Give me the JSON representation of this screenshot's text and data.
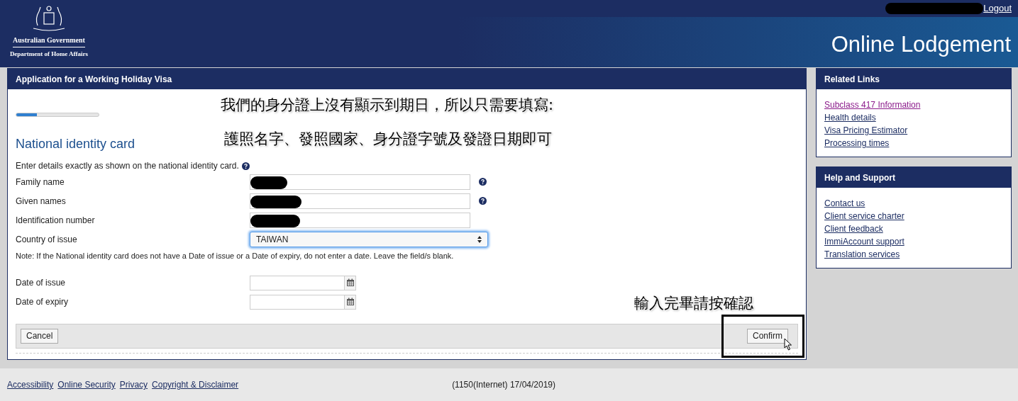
{
  "header": {
    "agency_line_1": "Australian Government",
    "agency_line_2": "Department of Home Affairs",
    "logout": "Logout",
    "site_title": "Online Lodgement"
  },
  "form": {
    "title": "Application for a Working Holiday Visa",
    "progress": {
      "level": 0.25
    },
    "section_title": "National identity card",
    "intro": "Enter details exactly as shown on the national identity card.",
    "fields": [
      {
        "kind": "text",
        "label": "Family name",
        "redacted": true,
        "help": true
      },
      {
        "kind": "text",
        "label": "Given names",
        "redacted": true,
        "help": true
      },
      {
        "kind": "text",
        "label": "Identification number",
        "redacted": true,
        "help": false
      },
      {
        "kind": "select",
        "label": "Country of issue",
        "value": "TAIWAN",
        "focused": true
      }
    ],
    "note": "Note: If the National identity card does not have a Date of issue or a Date of expiry, do not enter a date. Leave the field/s blank.",
    "date_fields": [
      {
        "label": "Date of issue"
      },
      {
        "label": "Date of expiry"
      }
    ],
    "buttons": {
      "cancel": "Cancel",
      "confirm": "Confirm"
    }
  },
  "annotations": [
    {
      "text": "我們的身分證上沒有顯示到期日，所以只需要填寫:"
    },
    {
      "text": "護照名字、發照國家、身分證字號及發證日期即可"
    },
    {
      "text": "輸入完畢請按確認"
    }
  ],
  "sidebar": [
    {
      "title": "Related Links",
      "links": [
        {
          "label": "Subclass 417 Information",
          "visited": true
        },
        {
          "label": "Health details",
          "visited": false
        },
        {
          "label": "Visa Pricing Estimator",
          "visited": false
        },
        {
          "label": "Processing times",
          "visited": false
        }
      ]
    },
    {
      "title": "Help and Support",
      "links": [
        {
          "label": "Contact us",
          "visited": false
        },
        {
          "label": "Client service charter",
          "visited": false
        },
        {
          "label": "Client feedback",
          "visited": false
        },
        {
          "label": "ImmiAccount support",
          "visited": false
        },
        {
          "label": "Translation services",
          "visited": false
        }
      ]
    }
  ],
  "footer": {
    "links": [
      "Accessibility",
      "Online Security",
      "Privacy",
      "Copyright & Disclaimer"
    ],
    "version": "(1150(Internet) 17/04/2019)"
  }
}
